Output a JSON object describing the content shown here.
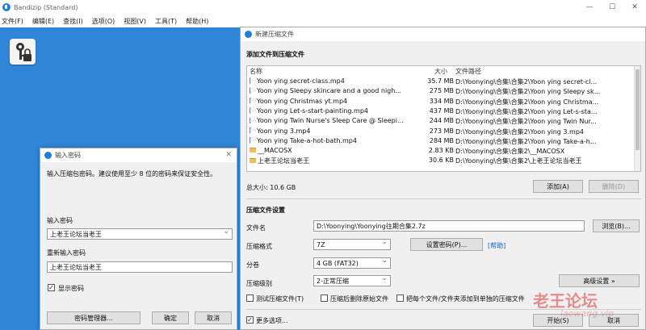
{
  "app": {
    "title": "Bandizip (Standard)",
    "win_min": "—",
    "win_max": "☐",
    "win_close": "✕"
  },
  "menu": [
    "文件(F)",
    "编辑(E)",
    "查找(I)",
    "选项(O)",
    "视图(V)",
    "工具(T)",
    "帮助(H)"
  ],
  "password_dialog": {
    "title": "输入密码",
    "message": "输入压缩包密码。建议使用至少 8 位的密码来保证安全性。",
    "password_label": "输入密码",
    "password_value": "上老王论坛当老王",
    "repeat_label": "重新输入密码",
    "repeat_value": "上老王论坛当老王",
    "show_password_label": "显示密码",
    "show_password_checked": "✓",
    "manager_button": "密码管理器...",
    "ok_button": "确定",
    "cancel_button": "取消"
  },
  "archive_dialog": {
    "title": "新建压缩文件",
    "add_section": "添加文件到压缩文件",
    "columns": {
      "name": "名称",
      "size": "大小",
      "path": "文件路径"
    },
    "files": [
      {
        "name": "Yoon ying secret-class.mp4",
        "size": "35.7 MB",
        "path": "D:\\Yoonying\\合集\\合集2\\Yoon ying secret-cl...",
        "type": "video"
      },
      {
        "name": "Yoon ying Sleepy skincare and a good nigh...",
        "size": "275 MB",
        "path": "D:\\Yoonying\\合集\\合集2\\Yoon ying Sleepy sk...",
        "type": "video"
      },
      {
        "name": "Yoon ying Christmas yt.mp4",
        "size": "334 MB",
        "path": "D:\\Yoonying\\合集\\合集2\\Yoon ying Christma...",
        "type": "video"
      },
      {
        "name": "Yoon ying Let-s-start-painting.mp4",
        "size": "437 MB",
        "path": "D:\\Yoonying\\合集\\合集2\\Yoon ying Let-s-sta...",
        "type": "video"
      },
      {
        "name": "Yoon ying Twin Nurse's Sleep Care @ Sleepi...",
        "size": "244 MB",
        "path": "D:\\Yoonying\\合集\\合集2\\Yoon ying Twin Nur...",
        "type": "video"
      },
      {
        "name": "Yoon ying 3.mp4",
        "size": "273 MB",
        "path": "D:\\Yoonying\\合集\\合集2\\Yoon ying 3.mp4",
        "type": "video"
      },
      {
        "name": "Yoon ying Take-a-hot-bath.mp4",
        "size": "284 MB",
        "path": "D:\\Yoonying\\合集\\合集2\\Yoon ying Take-a-h...",
        "type": "video"
      },
      {
        "name": "__MACOSX",
        "size": "2.83 KB",
        "path": "D:\\Yoonying\\合集\\合集2\\__MACOSX",
        "type": "folder"
      },
      {
        "name": "上老王论坛当老王",
        "size": "30.6 KB",
        "path": "D:\\Yoonying\\合集\\合集2\\上老王论坛当老王",
        "type": "folder"
      }
    ],
    "total_size": "总大小: 10.6 GB",
    "add_button": "添加(A)",
    "delete_button": "删除(D)",
    "settings_section": "压缩文件设置",
    "filename_label": "文件名",
    "filename_value": "D:\\Yoonying\\Yoonying往期合集2.7z",
    "browse_button": "浏览(B)...",
    "format_label": "压缩格式",
    "format_value": "7Z",
    "set_password_button": "设置密码(P)...",
    "help_link": "[帮助]",
    "split_label": "分卷",
    "split_value": "4 GB (FAT32)",
    "level_label": "压缩级别",
    "level_value": "2-正常压缩",
    "advanced_button": "高级设置 »",
    "test_label": "测试压缩文件(T)",
    "delete_after_label": "压缩后删除原始文件",
    "separate_label": "把每个文件/文件夹添加到单独的压缩文件",
    "more_options_label": "更多选项...",
    "more_options_checked": "✓",
    "start_button": "开始(S)",
    "cancel_button": "取消"
  },
  "watermark": {
    "text": "老王论坛",
    "sub": "laowang.vip"
  }
}
